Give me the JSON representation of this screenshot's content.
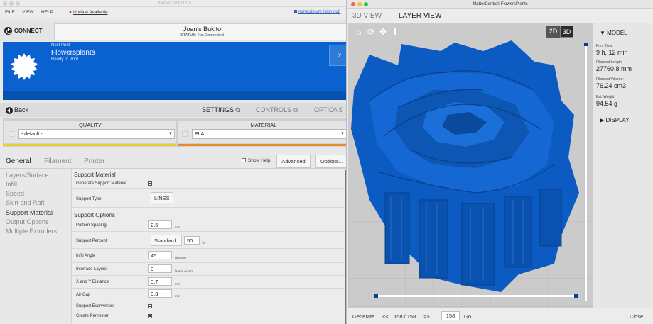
{
  "left_window": {
    "title": "MatterControl 1.5",
    "menu": [
      "FILE",
      "VIEW",
      "HELP"
    ],
    "update_label": "Update Available",
    "user_link": "nonscriptum (sign out)",
    "connect_label": "CONNECT",
    "printer_name": "Joan's Bukito",
    "printer_status": "STATUS: Not Connected",
    "next_print_label": "Next Print",
    "file_name": "Flowersplants",
    "ready_label": "Ready to Print",
    "temp": "0°",
    "back_label": "Back",
    "top_tabs": [
      "SETTINGS",
      "CONTROLS",
      "OPTIONS"
    ],
    "quality_header": "QUALITY",
    "quality_value": "- default -",
    "material_header": "MATERIAL",
    "material_value": "PLA",
    "settings_tabs": [
      "General",
      "Filament",
      "Printer"
    ],
    "show_help": "Show Help",
    "advanced_label": "Advanced",
    "options_label": "Options...",
    "categories": [
      "Layers/Surface",
      "Infill",
      "Speed",
      "Skirt and Raft",
      "Support Material",
      "Output Options",
      "Multiple Extruders"
    ],
    "support_material_header": "Support Material",
    "generate_support_label": "Generate Support Material",
    "support_type_label": "Support Type",
    "support_type_value": "LINES",
    "support_options_header": "Support Options",
    "pattern_spacing_label": "Pattern Spacing",
    "pattern_spacing_value": "2.5",
    "pattern_spacing_unit": "mm",
    "support_percent_label": "Support Percent",
    "support_percent_mode": "Standard",
    "support_percent_value": "50",
    "support_percent_unit": "%",
    "infill_angle_label": "Infill Angle",
    "infill_angle_value": "45",
    "infill_angle_unit": "degrees",
    "interface_layers_label": "Interface Layers",
    "interface_layers_value": "0",
    "interface_layers_unit": "layers or mm",
    "xy_distance_label": "X and Y Distance",
    "xy_distance_value": "0.7",
    "xy_distance_unit": "mm",
    "air_gap_label": "Air Gap",
    "air_gap_value": "0.3",
    "air_gap_unit": "mm",
    "support_everywhere_label": "Support Everywhere",
    "create_perimeter_label": "Create Perimeter"
  },
  "right_window": {
    "title": "MatterControl: FlowersPlants",
    "tabs": [
      "3D VIEW",
      "LAYER VIEW"
    ],
    "mode_2d": "2D",
    "mode_3d": "3D",
    "model_header": "MODEL",
    "print_time_label": "Print Time:",
    "print_time_value": "9 h, 12 min",
    "filament_length_label": "Filament Length:",
    "filament_length_value": "27760.8 mm",
    "filament_volume_label": "Filament Volume:",
    "filament_volume_value": "76.24 cm3",
    "est_weight_label": "Est. Weight:",
    "est_weight_value": "94.54 g",
    "display_header": "DISPLAY",
    "generate_label": "Generate",
    "prev": "<<",
    "layer_counter": "158 / 158",
    "next": ">>",
    "layer_input": "158",
    "go_label": "Go",
    "close_label": "Close"
  },
  "colors": {
    "accent_blue": "#0a62d0",
    "model_blue": "#0a5cc0",
    "quality_yellow": "#e9d12e",
    "material_orange": "#e98b2c"
  }
}
